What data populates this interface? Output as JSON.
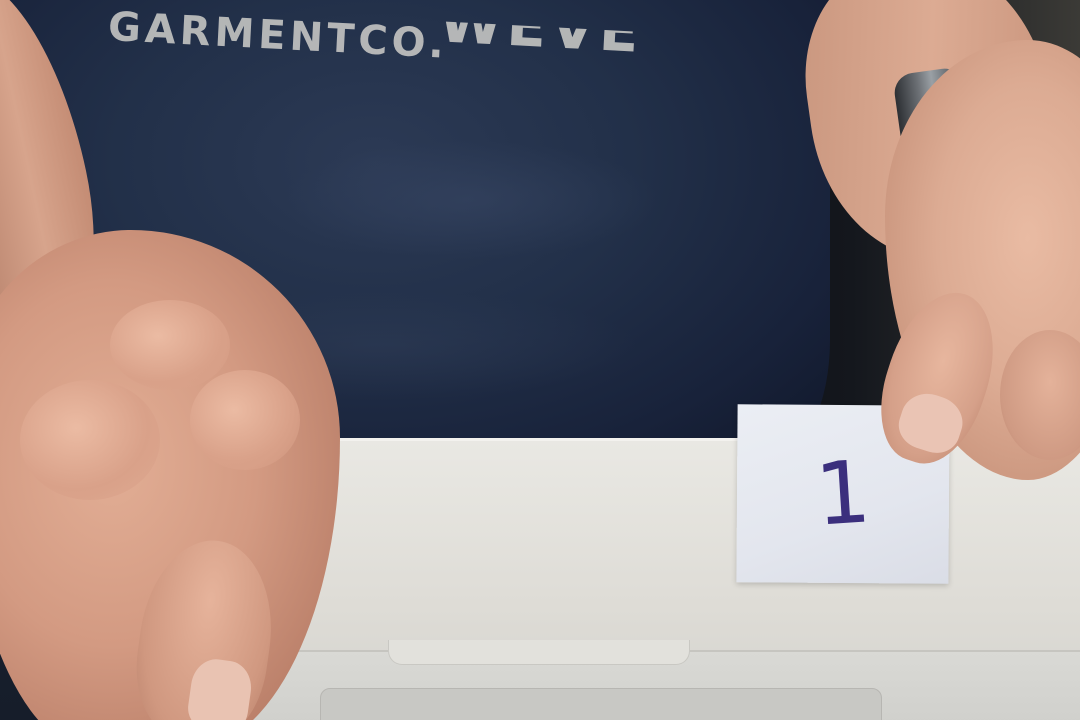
{
  "photo": {
    "shirt_print_line1": "WEVE",
    "shirt_print_line2": "GARMENTCO.",
    "note_text": "1"
  },
  "colors": {
    "shirt": "#223049",
    "laptop": "#e4e3de",
    "skin": "#d8a48c",
    "paper": "#e7e9f0",
    "ink": "#3b2f7d"
  }
}
